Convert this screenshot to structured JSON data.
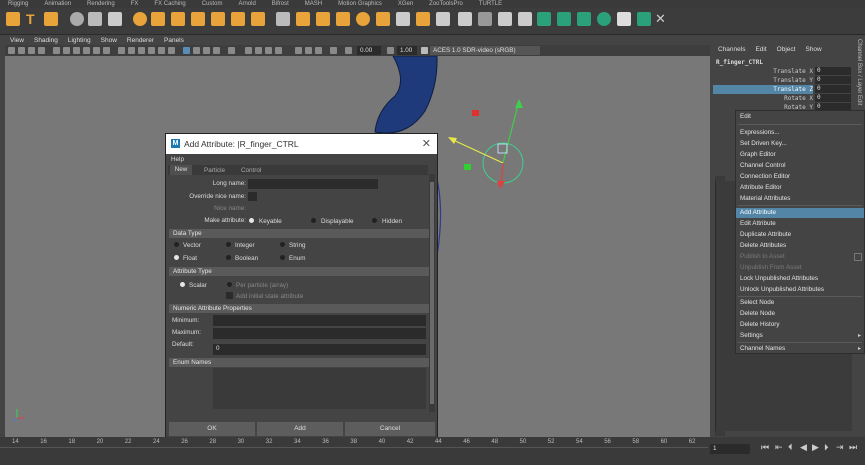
{
  "shelf_tabs": [
    "Rigging",
    "Animation",
    "Rendering",
    "FX",
    "FX Caching",
    "Custom",
    "Arnold",
    "Bifrost",
    "MASH",
    "Motion Graphics",
    "XGen",
    "ZooToolsPro",
    "TURTLE"
  ],
  "viewport": {
    "menu": [
      "View",
      "Shading",
      "Lighting",
      "Show",
      "Renderer",
      "Panels"
    ],
    "field1": "0.00",
    "field2": "1.00",
    "colorspace": "ACES 1.0 SDR-video (sRGB)"
  },
  "channel_box": {
    "menu": [
      "Channels",
      "Edit",
      "Object",
      "Show"
    ],
    "node_name": "R_finger_CTRL",
    "attrs": [
      {
        "label": "Translate X",
        "value": "0"
      },
      {
        "label": "Translate Y",
        "value": "0"
      },
      {
        "label": "Translate Z",
        "value": "0"
      },
      {
        "label": "Rotate X",
        "value": "0"
      },
      {
        "label": "Rotate Y",
        "value": "0"
      }
    ],
    "side_tab": "Channel Box / Layer Edit"
  },
  "context_menu": [
    {
      "label": "Edit",
      "state": "normal"
    },
    {
      "label": "Expressions...",
      "state": "normal"
    },
    {
      "label": "Set Driven Key...",
      "state": "normal"
    },
    {
      "label": "Graph Editor",
      "state": "normal"
    },
    {
      "label": "Channel Control",
      "state": "normal"
    },
    {
      "label": "Connection Editor",
      "state": "normal"
    },
    {
      "label": "Attribute Editor",
      "state": "normal"
    },
    {
      "label": "Material Attributes",
      "state": "normal"
    },
    {
      "label": "Add Attribute",
      "state": "highlight"
    },
    {
      "label": "Edit Attribute",
      "state": "normal"
    },
    {
      "label": "Duplicate Attribute",
      "state": "normal"
    },
    {
      "label": "Delete Attributes",
      "state": "normal"
    },
    {
      "label": "Publish to Asset",
      "state": "disabled"
    },
    {
      "label": "Unpublish From Asset",
      "state": "disabled"
    },
    {
      "label": "Lock Unpublished Attributes",
      "state": "normal"
    },
    {
      "label": "Unlock Unpublished Attributes",
      "state": "normal"
    },
    {
      "label": "Select Node",
      "state": "normal"
    },
    {
      "label": "Delete Node",
      "state": "normal"
    },
    {
      "label": "Delete History",
      "state": "normal"
    },
    {
      "label": "Settings",
      "state": "normal"
    },
    {
      "label": "Channel Names",
      "state": "normal"
    }
  ],
  "dialog": {
    "title": "Add Attribute: |R_finger_CTRL",
    "menu": "Help",
    "tabs": [
      "New",
      "Particle",
      "Control"
    ],
    "long_name_label": "Long name:",
    "long_name_value": "",
    "override_label": "Override nice name:",
    "nice_name_label": "Nice name:",
    "make_attr_label": "Make attribute:",
    "make_attr_options": [
      "Keyable",
      "Displayable",
      "Hidden"
    ],
    "data_type_header": "Data Type",
    "data_types": [
      "Vector",
      "Integer",
      "String",
      "Float",
      "Boolean",
      "Enum"
    ],
    "attr_type_header": "Attribute Type",
    "attr_types": [
      "Scalar",
      "Per particle (array)"
    ],
    "add_initial": "Add initial state attribute",
    "numeric_header": "Numeric Attribute Properties",
    "minimum_label": "Minimum:",
    "minimum_value": "",
    "maximum_label": "Maximum:",
    "maximum_value": "",
    "default_label": "Default:",
    "default_value": "0",
    "enum_header": "Enum Names",
    "buttons": {
      "ok": "OK",
      "add": "Add",
      "cancel": "Cancel"
    }
  },
  "timeline": {
    "ticks": [
      "14",
      "16",
      "18",
      "20",
      "22",
      "24",
      "26",
      "28",
      "30",
      "32",
      "34",
      "36",
      "38",
      "40",
      "42",
      "44",
      "46",
      "48",
      "50",
      "52",
      "54",
      "56",
      "58",
      "60",
      "62"
    ],
    "current_frame": "1"
  }
}
